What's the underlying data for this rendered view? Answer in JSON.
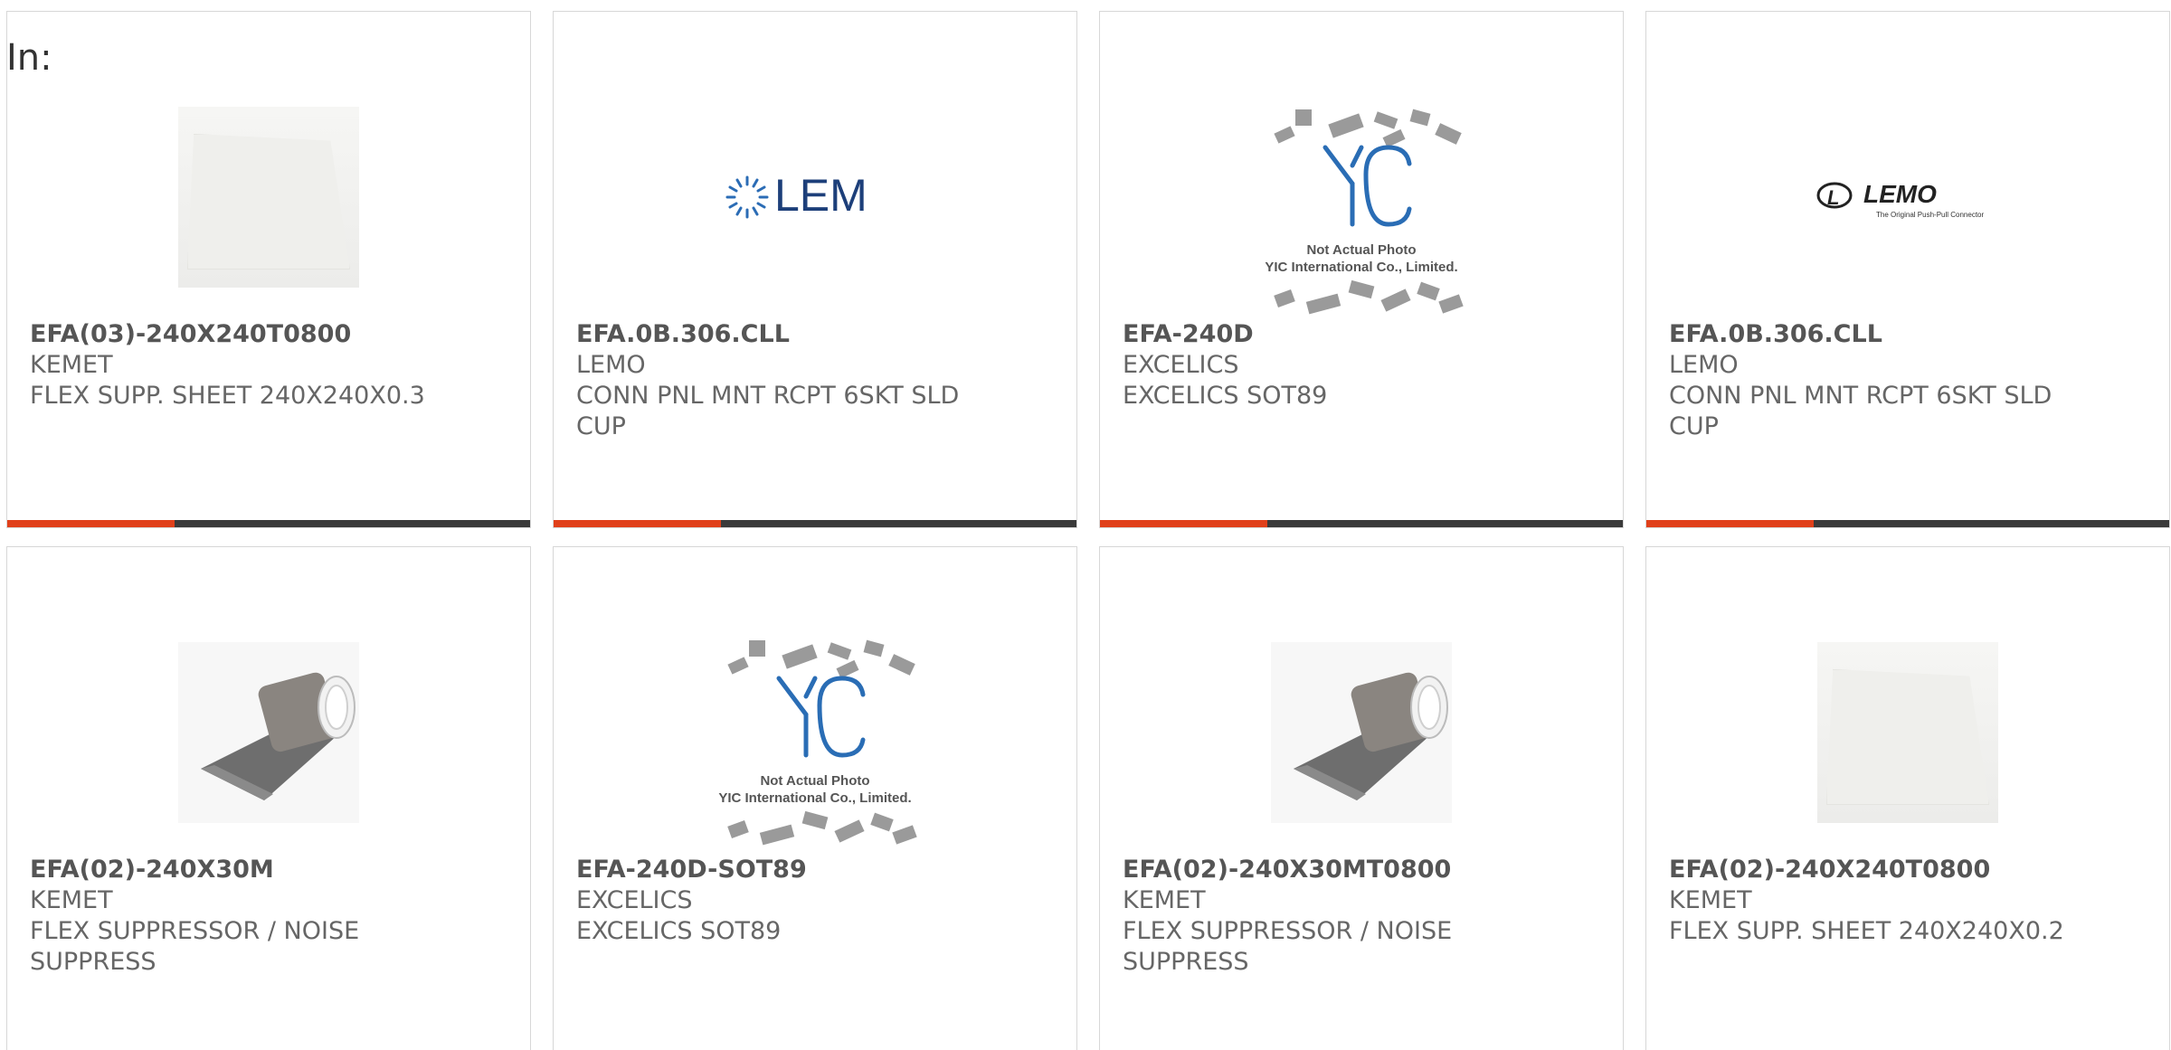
{
  "header": {
    "in_label": "In:"
  },
  "products": [
    {
      "part": "EFA(03)-240X240T0800",
      "manufacturer": "KEMET",
      "description": "FLEX SUPP. SHEET 240X240X0.3",
      "image": "sheet-icon"
    },
    {
      "part": "EFA.0B.306.CLL",
      "manufacturer": "LEMO",
      "description": "CONN PNL MNT RCPT 6SKT SLD CUP",
      "image": "lem-logo",
      "logo_text": "LEM"
    },
    {
      "part": "EFA-240D",
      "manufacturer": "EXCELICS",
      "description": "EXCELICS SOT89",
      "image": "yic-placeholder",
      "logo_text": "YIC",
      "caption1": "Not Actual Photo",
      "caption2": "YIC International Co., Limited."
    },
    {
      "part": "EFA.0B.306.CLL",
      "manufacturer": "LEMO",
      "description": "CONN PNL MNT RCPT 6SKT SLD CUP",
      "image": "lemo-logo",
      "logo_text": "LEMO",
      "tagline": "The Original Push-Pull Connector"
    },
    {
      "part": "EFA(02)-240X30M",
      "manufacturer": "KEMET",
      "description": "FLEX SUPPRESSOR / NOISE SUPPRESS",
      "image": "roll-icon"
    },
    {
      "part": "EFA-240D-SOT89",
      "manufacturer": "EXCELICS",
      "description": "EXCELICS SOT89",
      "image": "yic-placeholder",
      "logo_text": "YIC",
      "caption1": "Not Actual Photo",
      "caption2": "YIC International Co., Limited."
    },
    {
      "part": "EFA(02)-240X30MT0800",
      "manufacturer": "KEMET",
      "description": "FLEX SUPPRESSOR / NOISE SUPPRESS",
      "image": "roll-icon"
    },
    {
      "part": "EFA(02)-240X240T0800",
      "manufacturer": "KEMET",
      "description": "FLEX SUPP. SHEET 240X240X0.2",
      "image": "sheet-icon"
    }
  ],
  "colors": {
    "accent": "#e0401a",
    "bar_dark": "#3a3a3a",
    "text": "#666666",
    "lem_blue": "#1d3f7a",
    "yic_blue": "#2a6db5"
  }
}
